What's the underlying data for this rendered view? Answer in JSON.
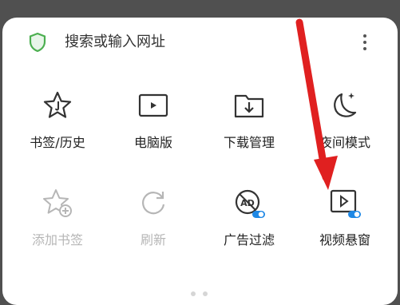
{
  "address_bar": {
    "placeholder": "搜索或输入网址"
  },
  "grid": {
    "row1": [
      {
        "label": "书签/历史",
        "icon": "star-icon",
        "enabled": true
      },
      {
        "label": "电脑版",
        "icon": "desktop-icon",
        "enabled": true
      },
      {
        "label": "下载管理",
        "icon": "download-folder-icon",
        "enabled": true
      },
      {
        "label": "夜间模式",
        "icon": "moon-icon",
        "enabled": true
      }
    ],
    "row2": [
      {
        "label": "添加书签",
        "icon": "add-star-icon",
        "enabled": false
      },
      {
        "label": "刷新",
        "icon": "refresh-icon",
        "enabled": false
      },
      {
        "label": "广告过滤",
        "icon": "ad-block-icon",
        "enabled": true,
        "toggle": "on"
      },
      {
        "label": "视频悬窗",
        "icon": "video-window-icon",
        "enabled": true,
        "toggle": "on"
      }
    ]
  },
  "pager": {
    "pages": 2,
    "current": 1
  },
  "colors": {
    "shield_green": "#4caf50",
    "toggle_blue": "#1e88e5",
    "arrow_red": "#e02020"
  }
}
